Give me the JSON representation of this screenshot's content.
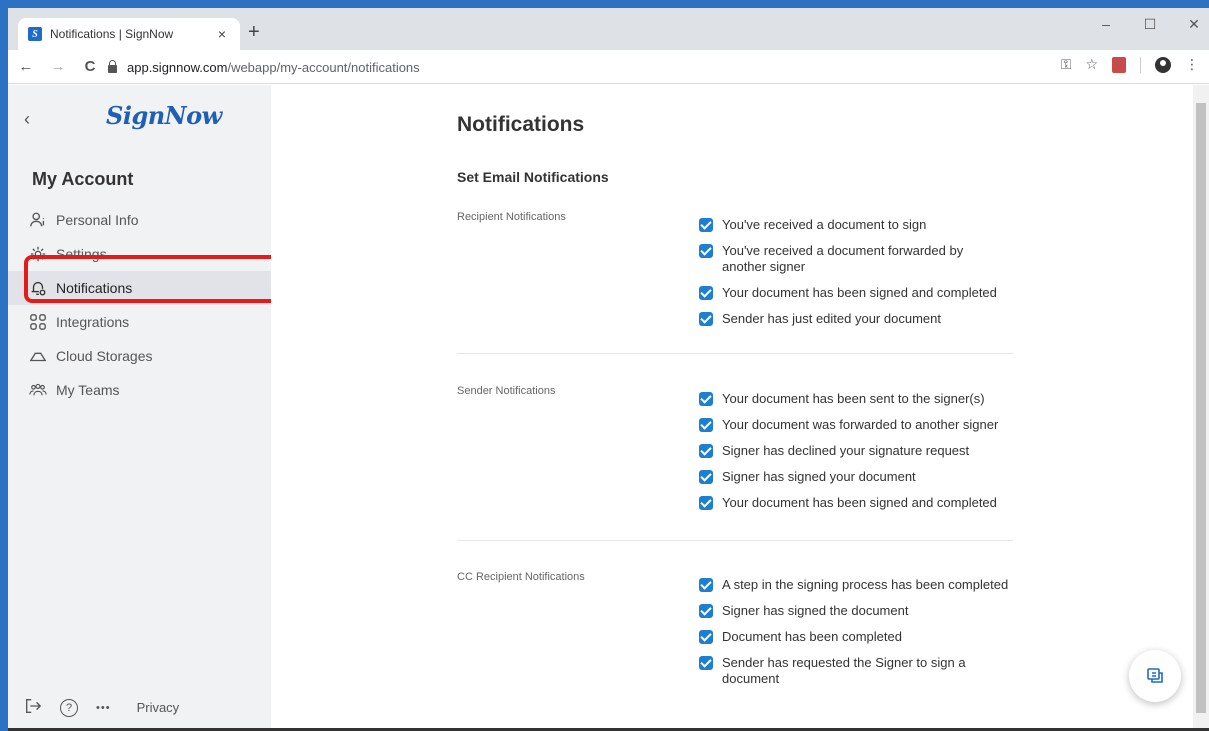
{
  "browser": {
    "tab_title": "Notifications | SignNow",
    "tab_close": "×",
    "new_tab": "+",
    "url_host": "app.signnow.com",
    "url_path": "/webapp/my-account/notifications",
    "minimize": "–",
    "maximize": "☐",
    "close": "✕",
    "back": "←",
    "forward": "→",
    "reload": "C"
  },
  "sidebar": {
    "logo": "SignNow",
    "heading": "My Account",
    "items": [
      {
        "label": "Personal Info",
        "icon": "person-info-icon"
      },
      {
        "label": "Settings",
        "icon": "gear-icon"
      },
      {
        "label": "Notifications",
        "icon": "bell-icon",
        "active": true
      },
      {
        "label": "Integrations",
        "icon": "grid-icon"
      },
      {
        "label": "Cloud Storages",
        "icon": "cloud-icon"
      },
      {
        "label": "My Teams",
        "icon": "team-icon"
      }
    ],
    "footer": {
      "privacy": "Privacy",
      "help": "?",
      "more": "•••"
    }
  },
  "main": {
    "title": "Notifications",
    "section_title": "Set Email Notifications",
    "groups": [
      {
        "label": "Recipient Notifications",
        "options": [
          "You've received a document to sign",
          "You've received a document forwarded by another signer",
          "Your document has been signed and completed",
          "Sender has just edited your document"
        ]
      },
      {
        "label": "Sender Notifications",
        "options": [
          "Your document has been sent to the signer(s)",
          "Your document was forwarded to another signer",
          "Signer has declined your signature request",
          "Signer has signed your document",
          "Your document has been signed and completed"
        ]
      },
      {
        "label": "CC Recipient Notifications",
        "options": [
          "A step in the signing process has been completed",
          "Signer has signed the document",
          "Document has been completed",
          "Sender has requested the Signer to sign a document"
        ]
      }
    ]
  },
  "colors": {
    "accent": "#1e7fd1",
    "highlight": "#e31b1b",
    "logo": "#1f5fb5"
  }
}
